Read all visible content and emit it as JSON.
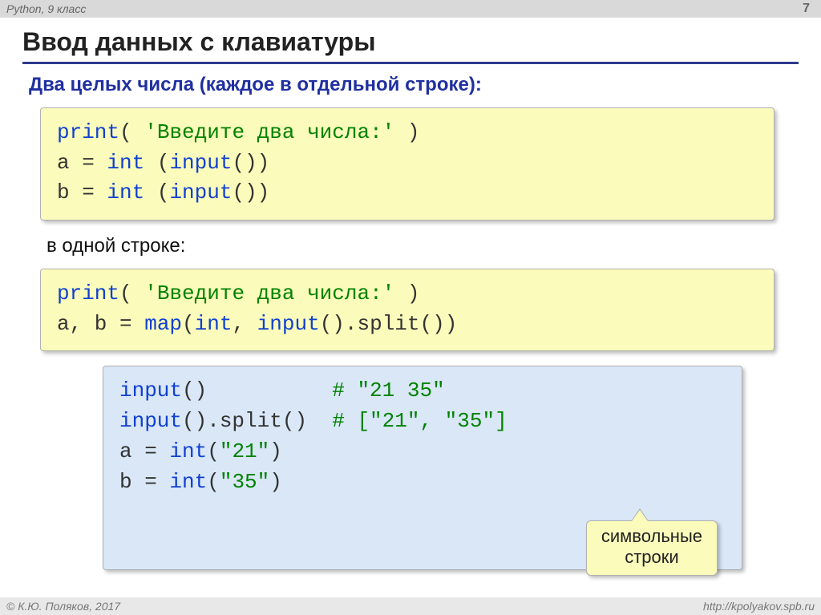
{
  "header": {
    "left": "Python, 9 класс",
    "page": "7"
  },
  "title": "Ввод данных с клавиатуры",
  "subtitle": "Два целых числа (каждое в отдельной строке):",
  "code1": {
    "l1a": "print",
    "l1b": "( ",
    "l1c": "'Введите два числа:'",
    "l1d": " )",
    "l2a": "a = ",
    "l2b": "int",
    "l2c": " (",
    "l2d": "input",
    "l2e": "())",
    "l3a": "b = ",
    "l3b": "int",
    "l3c": " (",
    "l3d": "input",
    "l3e": "())"
  },
  "note": "в одной строке:",
  "code2": {
    "l1a": "print",
    "l1b": "( ",
    "l1c": "'Введите два числа:'",
    "l1d": " )",
    "l2a": "a, b = ",
    "l2b": "map",
    "l2c": "(",
    "l2d": "int",
    "l2e": ", ",
    "l2f": "input",
    "l2g": "().split())"
  },
  "code3": {
    "l1a": "input",
    "l1b": "()          ",
    "l1c": "# \"21 35\"",
    "l2a": "input",
    "l2b": "().split()  ",
    "l2c": "# [\"21\", \"35\"]",
    "l3a": "a = ",
    "l3b": "int",
    "l3c": "(",
    "l3d": "\"21\"",
    "l3e": ")",
    "l4a": "b = ",
    "l4b": "int",
    "l4c": "(",
    "l4d": "\"35\"",
    "l4e": ")"
  },
  "callout": {
    "line1": "символьные",
    "line2": "строки"
  },
  "footer": {
    "left": "© К.Ю. Поляков, 2017",
    "right": "http://kpolyakov.spb.ru"
  }
}
